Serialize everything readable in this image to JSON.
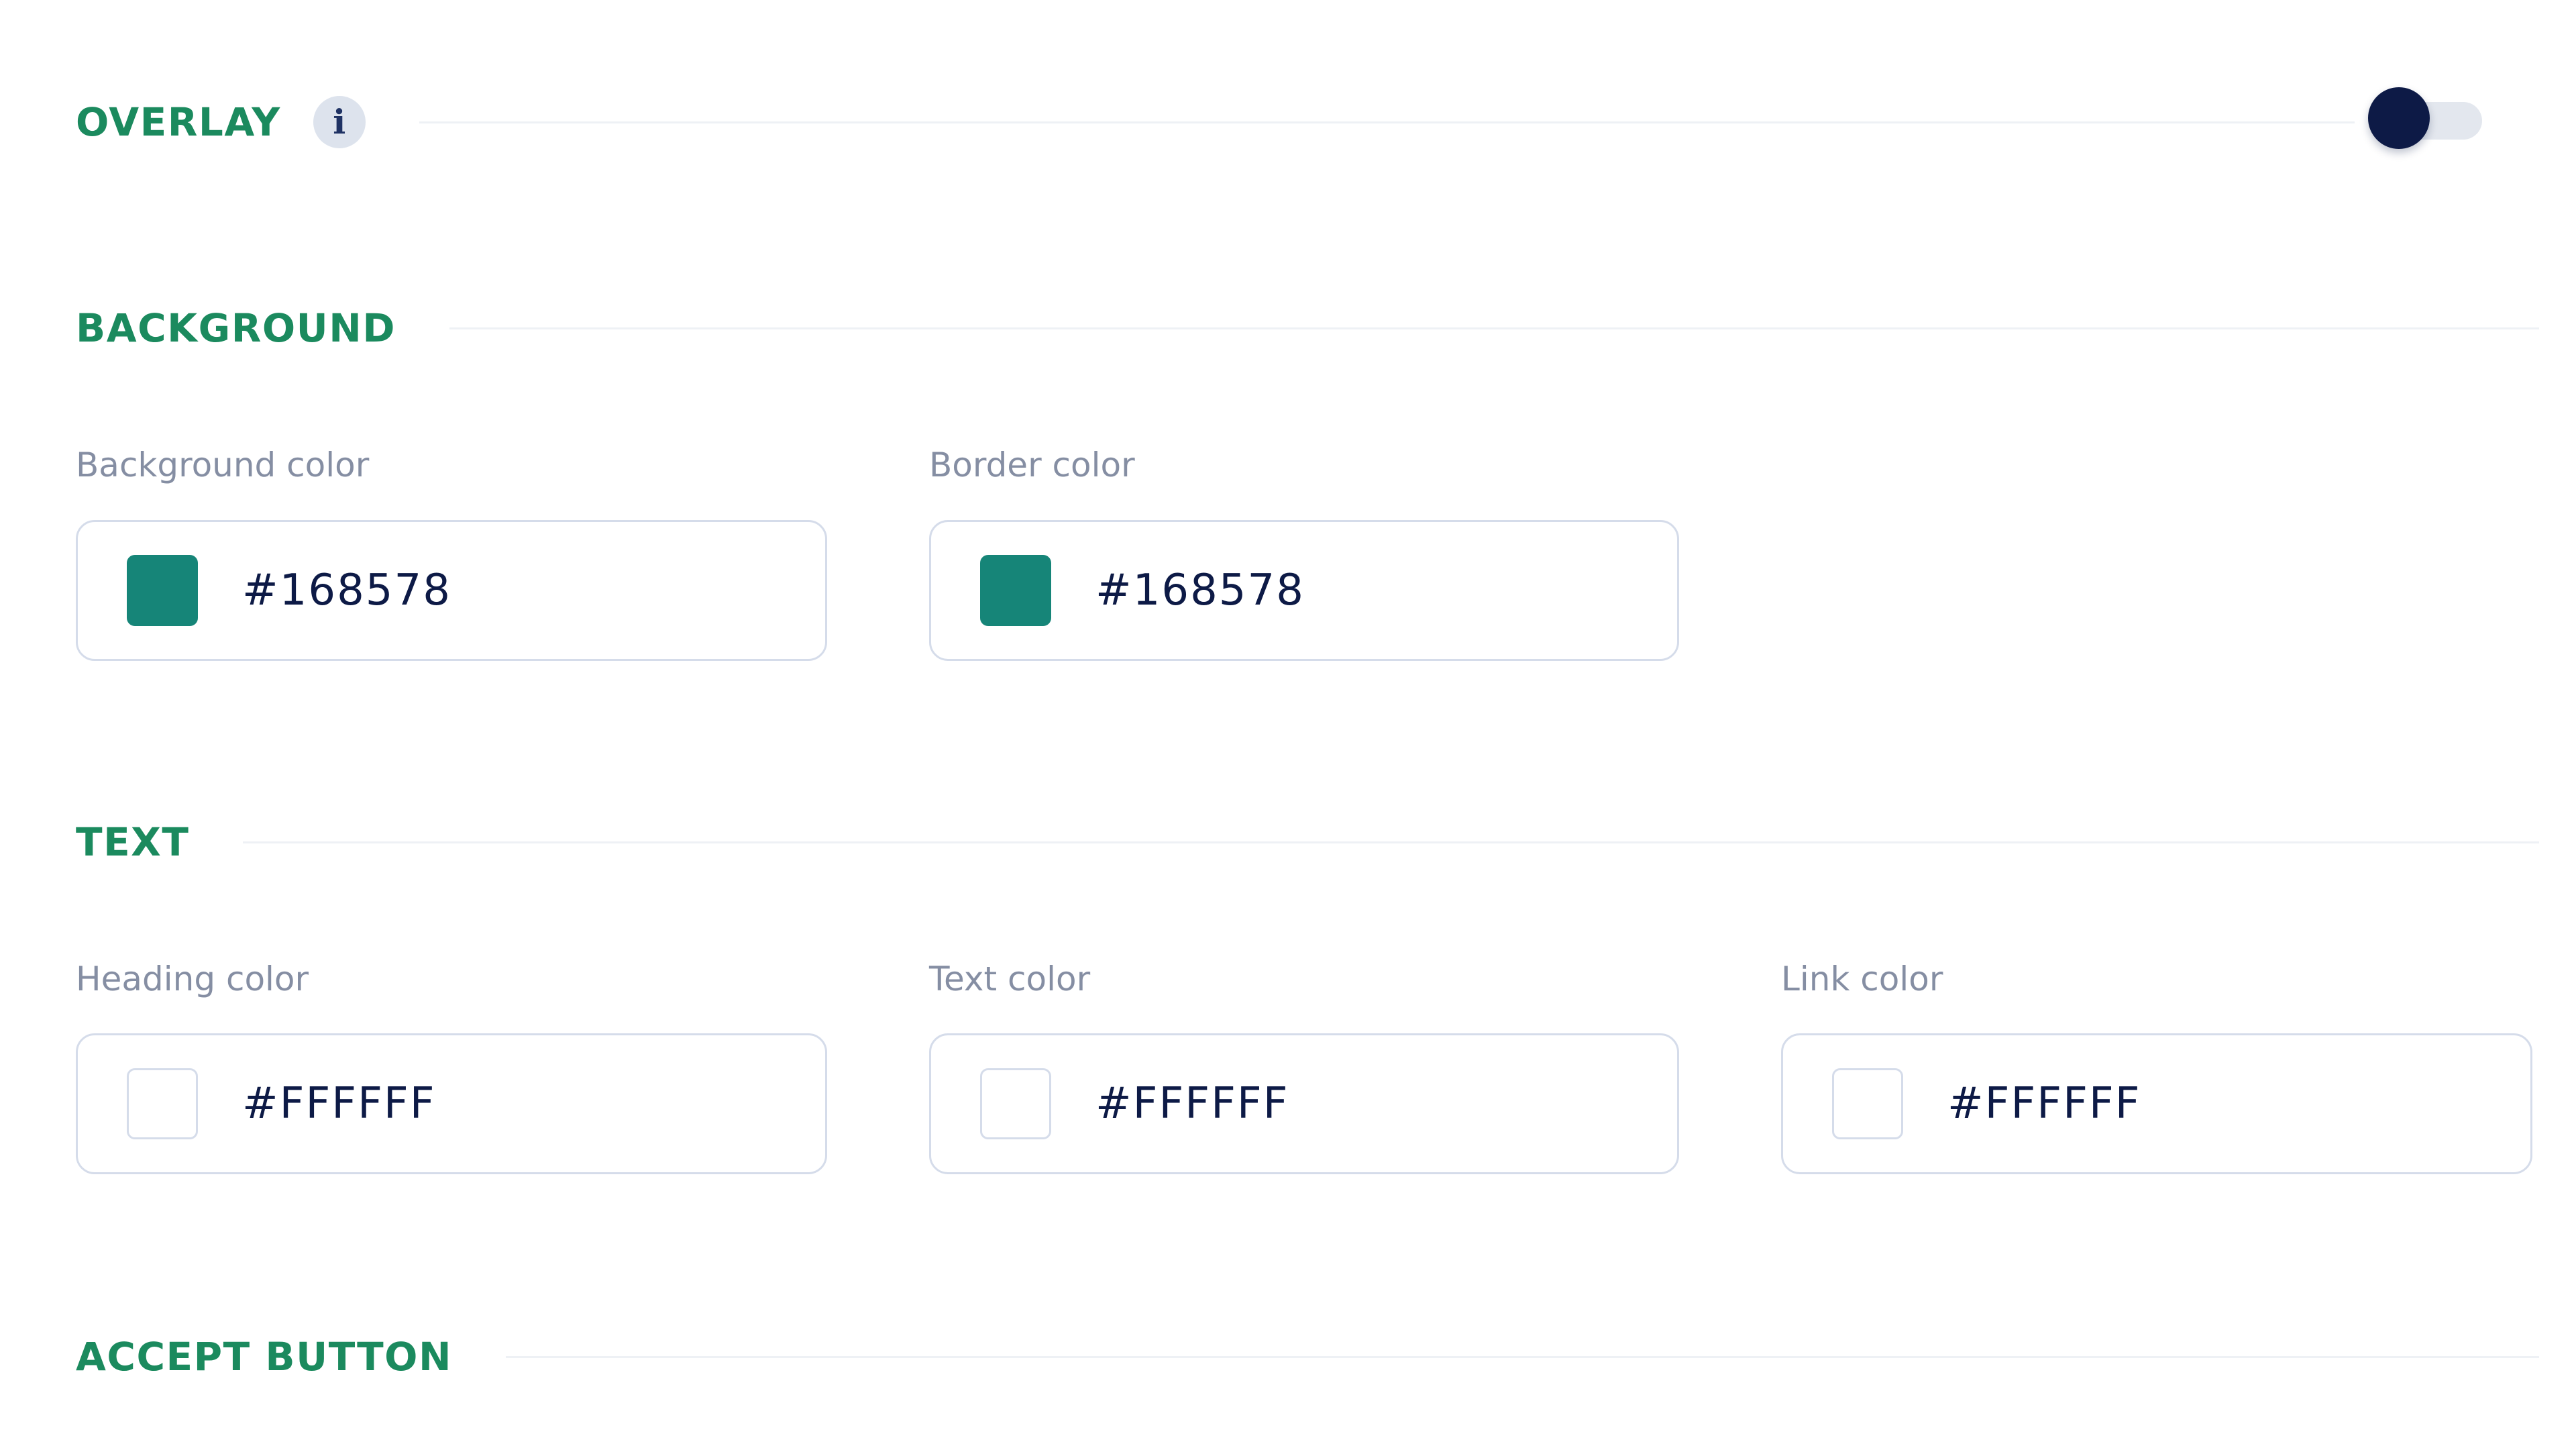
{
  "colors": {
    "section_title": "#1b8a5e",
    "label": "#858ea3",
    "value": "#0d1a46",
    "toggle_knob": "#0d1a46",
    "toggle_track": "#e3e7ee",
    "input_border": "#d5dcea"
  },
  "overlay": {
    "title": "OVERLAY",
    "info_icon": "i",
    "toggle_on": false
  },
  "background": {
    "title": "BACKGROUND",
    "background_color": {
      "label": "Background color",
      "value": "#168578",
      "swatch": "#168578"
    },
    "border_color": {
      "label": "Border color",
      "value": "#168578",
      "swatch": "#168578"
    }
  },
  "text": {
    "title": "TEXT",
    "heading_color": {
      "label": "Heading color",
      "value": "#FFFFFF",
      "swatch": "#FFFFFF"
    },
    "text_color": {
      "label": "Text color",
      "value": "#FFFFFF",
      "swatch": "#FFFFFF"
    },
    "link_color": {
      "label": "Link color",
      "value": "#FFFFFF",
      "swatch": "#FFFFFF"
    }
  },
  "accept_button": {
    "title": "ACCEPT BUTTON"
  }
}
